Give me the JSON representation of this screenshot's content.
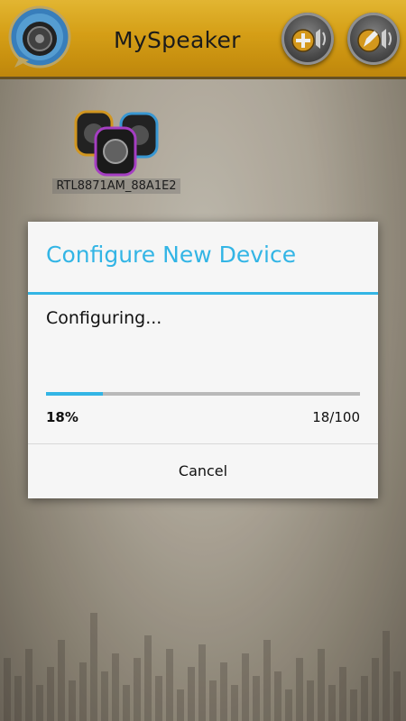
{
  "header": {
    "title": "MySpeaker",
    "logo_icon": "speaker-gear-logo-icon",
    "add_button_icon": "add-speaker-icon",
    "edit_button_icon": "edit-speaker-icon"
  },
  "devices": [
    {
      "name": "RTL8871AM_88A1E2",
      "icon": "speakers-icon"
    }
  ],
  "dialog": {
    "title": "Configure New Device",
    "message": "Configuring...",
    "progress_percent_text": "18%",
    "progress_count_text": "18/100",
    "progress_value": 18,
    "progress_max": 100,
    "cancel_label": "Cancel"
  },
  "colors": {
    "accent": "#33b5e5",
    "header": "#e4a915"
  }
}
